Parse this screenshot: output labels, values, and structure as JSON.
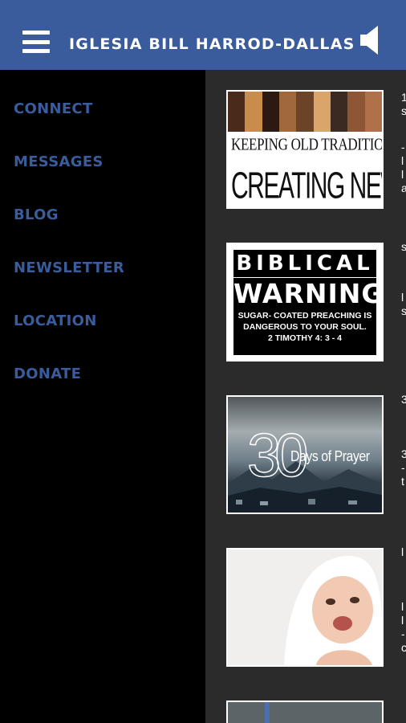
{
  "header": {
    "title": "IGLESIA BILL HARROD-DALLAS",
    "menu_icon": "hamburger-menu-icon",
    "sound_icon": "speaker-icon"
  },
  "nav": {
    "items": [
      {
        "label": "CONNECT"
      },
      {
        "label": "MESSAGES"
      },
      {
        "label": "BLOG"
      },
      {
        "label": "NEWSLETTER"
      },
      {
        "label": "LOCATION"
      },
      {
        "label": "DONATE"
      }
    ]
  },
  "posts": [
    {
      "thumb_line1": "KEEPING OLD TRADITIONS,",
      "thumb_line2": "CREATING NEW ONES"
    },
    {
      "thumb_title": "BIBLICAL",
      "thumb_big": "WARNING",
      "thumb_text1": "SUGAR- COATED PREACHING IS",
      "thumb_text2": "DANGEROUS TO YOUR SOUL.",
      "thumb_ref": "2 TIMOTHY 4: 3 - 4"
    },
    {
      "thumb_number": "30",
      "thumb_label": "Days of Prayer"
    },
    {
      "thumb_desc": "smiling baby in towel"
    },
    {
      "thumb_desc": "partial thumbnail"
    }
  ],
  "colors": {
    "accent": "#3a5b9c",
    "drawer_bg": "#000000",
    "content_bg": "#2b2b2b"
  }
}
